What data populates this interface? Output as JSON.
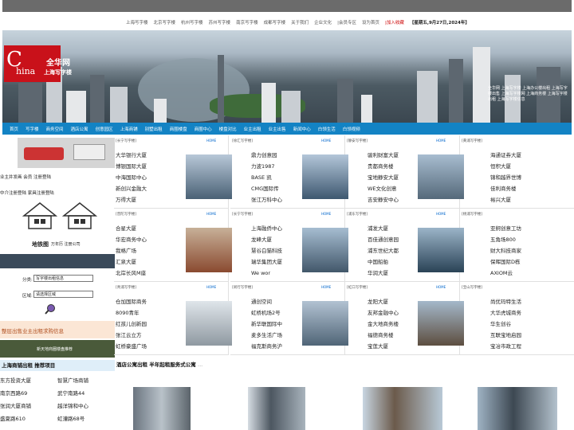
{
  "top_links": [
    "上海写字楼",
    "北京写字楼",
    "杭州写字楼",
    "苏州写字楼",
    "南京写字楼",
    "成都写字楼",
    "关于我们",
    "企业文化",
    "|会员专区",
    "设为首页"
  ],
  "top_fav": "|加入收藏",
  "top_date": "【星期五,9月27日,2024年】",
  "logo": {
    "big": "全华网",
    "small": "上海写字楼",
    "c": "C",
    "hina": "hina"
  },
  "banner_text": "全华网 上海写字楼 上海办公楼出租 上海写字楼出售 上海写字楼网 上海商务楼 上海写字楼出租 上海写字楼信息",
  "nav": [
    "首页",
    "写字楼",
    "商务空间",
    "酒店公寓",
    "创意园区",
    "上海商铺",
    "别墅出租",
    "商圈楼盘",
    "商圈中心",
    "楼盘对比",
    "业主出租",
    "业主出售",
    "新闻中心",
    "白领生活",
    "白领视频"
  ],
  "left": {
    "owner_line": "业主井发画 会员 注册登陆",
    "agent_line": "中介注册登陆 家具注册登陆",
    "map_title": "地铁图",
    "map_sub": "万年历 注册公司",
    "search_label_type": "分类:",
    "search_type_value": "写字楼出租信息",
    "search_label_area": "区域:",
    "search_area_value": "请选择区域",
    "ad1": "整层出售业主出租求购信息",
    "ad2": "新天地商圈楼盘推荐"
  },
  "recommend": {
    "title": "上海商铺出租 推荐项目",
    "items": [
      [
        "东方投资大厦",
        "智慧广场商铺"
      ],
      [
        "南京西路69",
        "武宁南路44"
      ],
      [
        "张润大厦商铺",
        "越洋锦和中心"
      ],
      [
        "盛夏路610",
        "虹漕路68号"
      ]
    ]
  },
  "cells": [
    {
      "header": "[长宁写字楼]",
      "items": [
        "大华银行大厦",
        "博银国际大厦",
        "中海国际中心",
        "新创兴金融大",
        "万得大厦"
      ]
    },
    {
      "header": "[徐汇写字楼]",
      "items": [
        "鼎力创意园",
        "力波1987",
        "BASE 凯",
        "CMG国际传",
        "张江万科中心"
      ]
    },
    {
      "header": "[静安写字楼]",
      "items": [
        "骏利财富大厦",
        "贵都商务楼",
        "宝地静安大厦",
        "WE文化创意",
        "吉安静安中心"
      ]
    },
    {
      "header": "[黄浦写字楼]",
      "items": [
        "海通证券大厦",
        "恒积大厦",
        "锦和越界世博",
        "佳利商务楼",
        "裕兴大厦"
      ]
    },
    {
      "header": "[普陀写字楼]",
      "items": [
        "合星大厦",
        "华宏商务中心",
        "我格广场",
        "汇泉大厦",
        "北岸长风M座"
      ]
    },
    {
      "header": "[长宁写字楼]",
      "items": [
        "上海融侨中心",
        "龙峰大厦",
        "慧谷白猫科技",
        "瑞华集团大厦",
        "We wor"
      ]
    },
    {
      "header": "[浦东写字楼]",
      "items": [
        "浦发大厦",
        "百佳通创意园",
        "浦东世纪大都",
        "中国船舶",
        "华润大厦"
      ]
    },
    {
      "header": "[杨浦写字楼]",
      "items": [
        "亚舸创意工坊",
        "五角场800",
        "财大科技商家",
        "保晖国际D栋",
        "AXIOM云"
      ]
    },
    {
      "header": "[青浦写字楼]",
      "items": [
        "仓加国际商务",
        "8090青年",
        "红孩儿创新园",
        "张江云立方",
        "虹桥豪盛广场"
      ]
    },
    {
      "header": "[闵行写字楼]",
      "items": [
        "通创空间",
        "虹桥机场2号",
        "新华联国际中",
        "麦多生活广场",
        "福克斯商务沪"
      ]
    },
    {
      "header": "[虹口写字楼]",
      "items": [
        "龙阳大厦",
        "友邦金融中心",
        "金大地商务楼",
        "福德商务楼",
        "宝莲大厦"
      ]
    },
    {
      "header": "[宝山写字楼]",
      "items": [
        "尚优玛特生活",
        "大华虎城商务",
        "华生创谷",
        "互联宝地启园",
        "宝冶市政工程"
      ]
    }
  ],
  "home_tag": "HOME",
  "bottom_title": "酒店公寓出租 半年起租服务式公寓",
  "bottom_more": "..."
}
